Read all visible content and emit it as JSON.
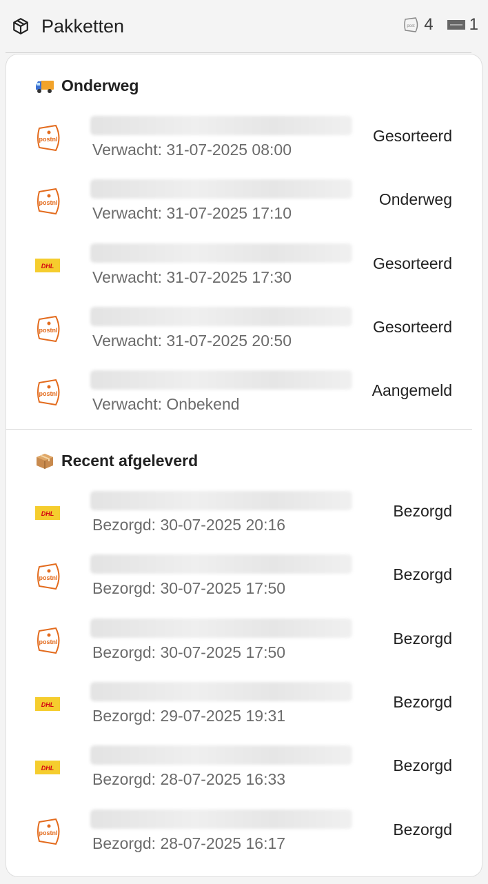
{
  "header": {
    "title": "Pakketten",
    "postnl_count": "4",
    "dhl_count": "1"
  },
  "colors": {
    "postnl": "#e36b1d",
    "dhl": "#f5cd2e",
    "dhl_red": "#d40511"
  },
  "sections": [
    {
      "title": "Onderweg",
      "icon": "truck-emoji",
      "items": [
        {
          "carrier": "postnl",
          "sub": "Verwacht: 31-07-2025 08:00",
          "status": "Gesorteerd"
        },
        {
          "carrier": "postnl",
          "sub": "Verwacht: 31-07-2025 17:10",
          "status": "Onderweg"
        },
        {
          "carrier": "dhl",
          "sub": "Verwacht: 31-07-2025 17:30",
          "status": "Gesorteerd"
        },
        {
          "carrier": "postnl",
          "sub": "Verwacht: 31-07-2025 20:50",
          "status": "Gesorteerd"
        },
        {
          "carrier": "postnl",
          "sub": "Verwacht: Onbekend",
          "status": "Aangemeld"
        }
      ]
    },
    {
      "title": "Recent afgeleverd",
      "icon": "package-emoji",
      "items": [
        {
          "carrier": "dhl",
          "sub": "Bezorgd: 30-07-2025 20:16",
          "status": "Bezorgd"
        },
        {
          "carrier": "postnl",
          "sub": "Bezorgd: 30-07-2025 17:50",
          "status": "Bezorgd"
        },
        {
          "carrier": "postnl",
          "sub": "Bezorgd: 30-07-2025 17:50",
          "status": "Bezorgd"
        },
        {
          "carrier": "dhl",
          "sub": "Bezorgd: 29-07-2025 19:31",
          "status": "Bezorgd"
        },
        {
          "carrier": "dhl",
          "sub": "Bezorgd: 28-07-2025 16:33",
          "status": "Bezorgd"
        },
        {
          "carrier": "postnl",
          "sub": "Bezorgd: 28-07-2025 16:17",
          "status": "Bezorgd"
        }
      ]
    }
  ]
}
